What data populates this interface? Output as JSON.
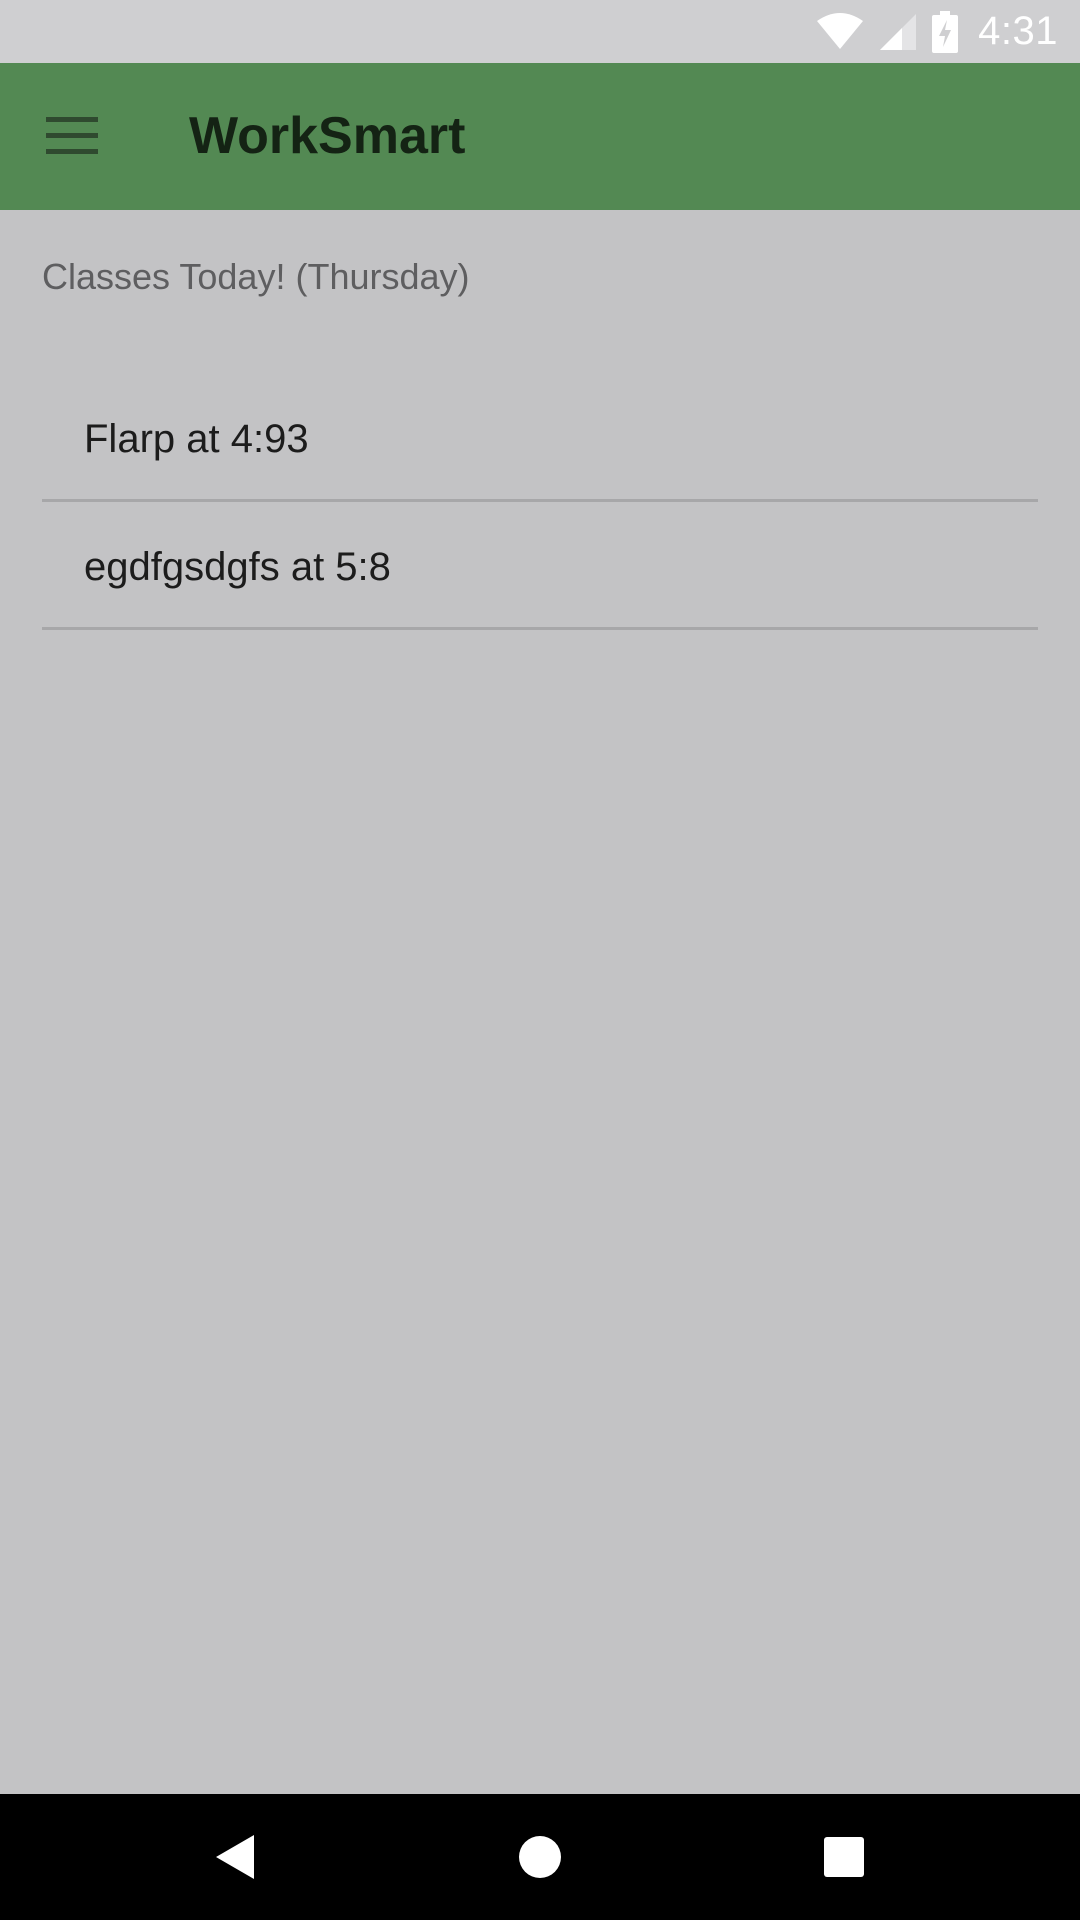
{
  "status_bar": {
    "time": "4:31",
    "icons": [
      "wifi-icon",
      "signal-icon",
      "battery-charging-icon"
    ]
  },
  "app_bar": {
    "title": "WorkSmart",
    "background_color": "#538953",
    "menu_icon": "hamburger-menu-icon"
  },
  "main": {
    "section_header": "Classes Today! (Thursday)",
    "classes": [
      {
        "label": "Flarp at 4:93"
      },
      {
        "label": "egdfgsdgfs at 5:8"
      }
    ]
  },
  "nav_bar": {
    "buttons": [
      "back-icon",
      "home-icon",
      "recents-icon"
    ]
  }
}
